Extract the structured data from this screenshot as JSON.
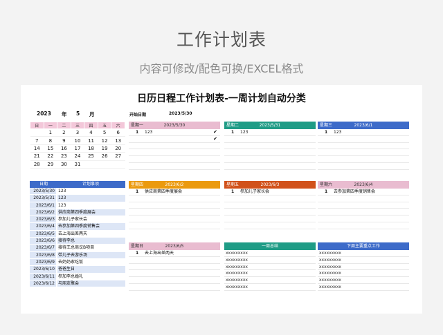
{
  "header": {
    "title": "工作计划表",
    "subtitle": "内容可修改/配色可换/EXCEL格式"
  },
  "sheet": {
    "title": "日历日程工作计划表-一周计划自动分类"
  },
  "calendar": {
    "year": "2023",
    "year_label": "年",
    "month": "5",
    "month_label": "月",
    "weekdays": [
      "日",
      "一",
      "二",
      "三",
      "四",
      "五",
      "六"
    ],
    "weeks": [
      [
        "",
        "1",
        "2",
        "3",
        "4",
        "5",
        "6"
      ],
      [
        "7",
        "8",
        "9",
        "10",
        "11",
        "12",
        "13"
      ],
      [
        "14",
        "15",
        "16",
        "17",
        "18",
        "19",
        "20"
      ],
      [
        "21",
        "22",
        "23",
        "24",
        "25",
        "26",
        "27"
      ],
      [
        "28",
        "29",
        "30",
        "31",
        "",
        "",
        ""
      ]
    ]
  },
  "start": {
    "label": "开始日期",
    "value": "2023/5/30"
  },
  "colors": {
    "pink": "#e9bcd0",
    "green": "#1f9c86",
    "blue": "#3d6bc9",
    "orange": "#eb9a0e",
    "red": "#d1511a"
  },
  "days": [
    {
      "name": "星期一",
      "date": "2023/5/30",
      "entries": [
        {
          "n": "1",
          "t": "123",
          "c": "✔"
        },
        {
          "n": "",
          "t": "",
          "c": "✔"
        }
      ]
    },
    {
      "name": "星期二",
      "date": "2023/5/31",
      "entries": [
        {
          "n": "1",
          "t": "123",
          "c": ""
        }
      ]
    },
    {
      "name": "星期三",
      "date": "2023/6/1",
      "entries": [
        {
          "n": "1",
          "t": "123",
          "c": ""
        }
      ]
    },
    {
      "name": "星期四",
      "date": "2023/6/2",
      "entries": [
        {
          "n": "1",
          "t": "供应商第四季度展会",
          "c": ""
        }
      ]
    },
    {
      "name": "星期五",
      "date": "2023/6/3",
      "entries": [
        {
          "n": "1",
          "t": "参加儿子家长会",
          "c": ""
        }
      ]
    },
    {
      "name": "星期六",
      "date": "2023/6/4",
      "entries": [
        {
          "n": "1",
          "t": "去参加第四季度销售会",
          "c": ""
        }
      ]
    },
    {
      "name": "星期日",
      "date": "2023/6/5",
      "entries": [
        {
          "n": "1",
          "t": "去上海出差两天",
          "c": ""
        }
      ]
    }
  ],
  "summary": {
    "title": "一周总结",
    "lines": [
      "xxxxxxxxx",
      "xxxxxxxxx",
      "xxxxxxxxx",
      "xxxxxxxxx",
      "xxxxxxxxx",
      "xxxxxxxxx"
    ]
  },
  "nextweek": {
    "title": "下周主要重点工作",
    "lines": [
      "xxxxxxxxx",
      "xxxxxxxxx",
      "xxxxxxxxx",
      "xxxxxxxxx",
      "xxxxxxxxx",
      "xxxxxxxxx"
    ]
  },
  "list": {
    "col_date": "日期",
    "col_item": "计划事项",
    "rows": [
      {
        "date": "2023/5/30",
        "item": "123"
      },
      {
        "date": "2023/5/31",
        "item": "123"
      },
      {
        "date": "2023/6/1",
        "item": "123"
      },
      {
        "date": "2023/6/2",
        "item": "供应商第四季度展会"
      },
      {
        "date": "2023/6/3",
        "item": "参加儿子家长会"
      },
      {
        "date": "2023/6/4",
        "item": "去参加第四季度销售会"
      },
      {
        "date": "2023/6/5",
        "item": "去上海出差两天"
      },
      {
        "date": "2023/6/6",
        "item": "接待李总"
      },
      {
        "date": "2023/6/7",
        "item": "接待王总商议B项目"
      },
      {
        "date": "2023/6/8",
        "item": "带儿子去游乐场"
      },
      {
        "date": "2023/6/9",
        "item": "去奶奶家吃饭"
      },
      {
        "date": "2023/6/10",
        "item": "爸爸生日"
      },
      {
        "date": "2023/6/11",
        "item": "参加李总婚礼"
      },
      {
        "date": "2023/6/12",
        "item": "与朋友聚会"
      }
    ]
  }
}
